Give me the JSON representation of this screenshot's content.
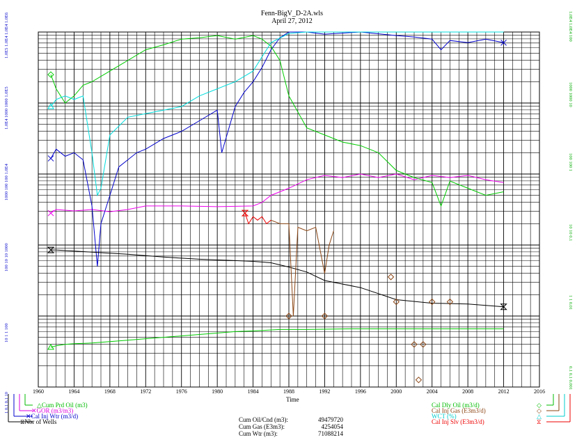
{
  "header": {
    "title": "Fenn-BigV_D-2A.wls",
    "date": "April 27, 2012"
  },
  "chart_data": {
    "type": "line",
    "title": "Fenn-BigV_D-2A.wls",
    "subtitle": "April 27, 2012",
    "xlabel": "Time",
    "x_ticks": [
      1960,
      1964,
      1968,
      1972,
      1976,
      1980,
      1984,
      1988,
      1992,
      1996,
      2000,
      2004,
      2008,
      2012,
      2016
    ],
    "xlim": [
      1960,
      2016
    ],
    "yscale": "log",
    "ylim_decades": 5,
    "grid": true,
    "left_axis_labels": [
      {
        "text": "1.0E5 1.0E4 1.0E4 1.0E6",
        "colors": [
          "#0000cc",
          "#cc00cc",
          "#00aa00",
          "#00cc00"
        ]
      },
      {
        "text": "1.0E4 1000 1000 1.0E5",
        "colors": [
          "#0000cc",
          "#cc00cc",
          "#00aa00",
          "#00cc00"
        ]
      },
      {
        "text": "1000 100 100 1.0E4",
        "colors": [
          "#0000cc",
          "#cc00cc",
          "#00aa00",
          "#00cc00"
        ]
      },
      {
        "text": "100 10 10 1000",
        "colors": [
          "#0000cc",
          "#cc00cc",
          "#00aa00",
          "#00cc00"
        ]
      },
      {
        "text": "10 1 1 100",
        "colors": [
          "#0000cc",
          "#cc00cc",
          "#00aa00",
          "#00cc00"
        ]
      },
      {
        "text": "1 0.1 0.1 10",
        "colors": [
          "#0000cc",
          "#cc00cc",
          "#00aa00",
          "#00cc00"
        ]
      }
    ],
    "right_axis_labels": [
      "1.0E4 1.0E4 100",
      "1000 1000 10",
      "100 100 1",
      "10 10 0.1",
      "1 1 0.01",
      "0.1 0.1 0.001"
    ],
    "series": [
      {
        "name": "Cum Prd Oil (m3)",
        "color": "#00cc00",
        "x": [
          1961.4,
          1962,
          1963,
          1964,
          1966,
          1968,
          1970,
          1972,
          1974,
          1976,
          1978,
          1980,
          1982,
          1984,
          1985.5,
          1987,
          1990,
          1995,
          2000,
          2005,
          2010,
          2012
        ],
        "y": [
          0.56,
          0.58,
          0.6,
          0.61,
          0.62,
          0.64,
          0.66,
          0.68,
          0.7,
          0.72,
          0.74,
          0.76,
          0.78,
          0.79,
          0.8,
          0.81,
          0.81,
          0.82,
          0.82,
          0.82,
          0.82,
          0.82
        ]
      },
      {
        "name": "GOR (m3/m3)",
        "color": "#ee00ee",
        "x": [
          1961.4,
          1962,
          1964,
          1966,
          1968,
          1970,
          1972,
          1976,
          1980,
          1984,
          1985,
          1986,
          1988,
          1990,
          1992,
          1994,
          1996,
          1998,
          2000,
          2002,
          2004,
          2006,
          2008,
          2010,
          2012
        ],
        "y": [
          2.45,
          2.5,
          2.48,
          2.5,
          2.47,
          2.5,
          2.55,
          2.55,
          2.54,
          2.55,
          2.6,
          2.7,
          2.8,
          2.92,
          2.98,
          2.95,
          3.0,
          2.95,
          3.0,
          2.92,
          2.98,
          2.95,
          2.98,
          2.92,
          2.88
        ]
      },
      {
        "name": "Cal Inj Wtr (m3/d)",
        "color": "#0000cc",
        "x": [
          1961.4,
          1962,
          1963,
          1964,
          1965,
          1966,
          1966.6,
          1967,
          1968,
          1969,
          1970,
          1971,
          1972,
          1974,
          1976,
          1978,
          1980,
          1980.5,
          1982,
          1983,
          1984,
          1985,
          1986,
          1987,
          1988,
          1990,
          1992,
          1996,
          2000,
          2002,
          2004,
          2005,
          2006,
          2008,
          2010,
          2012
        ],
        "y": [
          3.22,
          3.35,
          3.25,
          3.3,
          3.2,
          2.55,
          1.7,
          2.3,
          2.7,
          3.1,
          3.2,
          3.3,
          3.35,
          3.5,
          3.6,
          3.75,
          3.9,
          3.3,
          3.95,
          4.15,
          4.3,
          4.5,
          4.75,
          4.92,
          5.0,
          5.0,
          4.97,
          5.0,
          4.95,
          4.93,
          4.9,
          4.75,
          4.88,
          4.85,
          4.9,
          4.85
        ]
      },
      {
        "name": "Nbr of Wells",
        "color": "#000000",
        "x": [
          1961.4,
          1962,
          1966,
          1970,
          1974,
          1978,
          1982,
          1984,
          1986,
          1988,
          1990,
          1992,
          1996,
          2000,
          2004,
          2008,
          2010,
          2012
        ],
        "y": [
          1.93,
          1.93,
          1.9,
          1.87,
          1.83,
          1.8,
          1.78,
          1.77,
          1.75,
          1.69,
          1.62,
          1.5,
          1.4,
          1.23,
          1.18,
          1.17,
          1.15,
          1.13
        ]
      },
      {
        "name": "Cal Dly Oil (m3/d)",
        "color": "#00cc00",
        "x": [
          1961.4,
          1962,
          1963,
          1964,
          1965,
          1966,
          1968,
          1970,
          1972,
          1974,
          1976,
          1978,
          1980,
          1982,
          1984,
          1985,
          1986,
          1987,
          1988,
          1990,
          1992,
          1994,
          1996,
          1998,
          2000,
          2002,
          2004,
          2005,
          2006,
          2008,
          2010,
          2012
        ],
        "y": [
          4.4,
          4.2,
          4.0,
          4.1,
          4.25,
          4.3,
          4.45,
          4.6,
          4.75,
          4.82,
          4.9,
          4.92,
          4.95,
          4.9,
          4.95,
          4.9,
          4.8,
          4.6,
          4.1,
          3.65,
          3.55,
          3.45,
          3.4,
          3.3,
          3.05,
          2.95,
          2.88,
          2.55,
          2.9,
          2.8,
          2.7,
          2.75
        ]
      },
      {
        "name": "WCT (%)",
        "color": "#00dddd",
        "x": [
          1961.4,
          1962,
          1963,
          1964,
          1965,
          1966,
          1966.6,
          1967,
          1968,
          1970,
          1972,
          1974,
          1976,
          1978,
          1980,
          1982,
          1984,
          1985,
          1986,
          1988,
          1990,
          1996,
          2000,
          2004,
          2008,
          2012
        ],
        "y": [
          3.95,
          4.05,
          4.1,
          4.05,
          4.1,
          3.3,
          2.7,
          2.8,
          3.55,
          3.8,
          3.85,
          3.9,
          3.95,
          4.1,
          4.2,
          4.3,
          4.45,
          4.65,
          4.85,
          4.98,
          5.0,
          5.0,
          5.0,
          5.0,
          5.0,
          5.0
        ]
      },
      {
        "name": "Cal Inj Gas (E3m3/d)",
        "color": "#8b4513",
        "x": [
          1986,
          1987,
          1988,
          1988.5,
          1989,
          1990,
          1991,
          1992,
          1992.5,
          1993
        ],
        "y": [
          2.35,
          2.3,
          2.3,
          1.0,
          2.25,
          2.2,
          2.25,
          1.6,
          2.0,
          2.2
        ]
      },
      {
        "name": "Cal Inj Slv (E3m3/d)",
        "color": "#ee0000",
        "x": [
          1983.1,
          1983.5,
          1984,
          1984.5,
          1985,
          1985.5,
          1986
        ],
        "y": [
          2.45,
          2.3,
          2.4,
          2.35,
          2.4,
          2.3,
          2.35
        ]
      }
    ],
    "markers": {
      "cal_inj_gas": [
        {
          "x": 1988.0,
          "y": 1.0
        },
        {
          "x": 1992.0,
          "y": 1.0
        },
        {
          "x": 1999.4,
          "y": 1.55
        },
        {
          "x": 2000.0,
          "y": 1.2
        },
        {
          "x": 2002.0,
          "y": 0.6
        },
        {
          "x": 2003.0,
          "y": 0.6
        },
        {
          "x": 2002.5,
          "y": 0.1
        },
        {
          "x": 2004.0,
          "y": 1.2
        },
        {
          "x": 2006.0,
          "y": 1.2
        }
      ]
    }
  },
  "legend": {
    "left": [
      {
        "symbol": "△",
        "label": "Cum Prd Oil (m3)",
        "color": "#00bb00"
      },
      {
        "symbol": "✕",
        "label": "GOR (m3/m3)",
        "color": "#dd00dd"
      },
      {
        "symbol": "✕",
        "label": "Cal Inj Wtr (m3/d)",
        "color": "#0000cc"
      },
      {
        "symbol": "⧖",
        "label": "Nbr of Wells",
        "color": "#000000"
      }
    ],
    "right": [
      {
        "symbol": "◇",
        "label": "Cal Dly Oil (m3/d)",
        "color": "#00bb00"
      },
      {
        "symbol": "◇",
        "label": "Cal Inj Gas (E3m3/d)",
        "color": "#8b4513"
      },
      {
        "symbol": "△",
        "label": "WCT (%)",
        "color": "#00cccc"
      },
      {
        "symbol": "⧖",
        "label": "Cal Inj Slv (E3m3/d)",
        "color": "#ee0000"
      }
    ]
  },
  "summary": [
    {
      "label": "Cum Oil/Cnd (m3):",
      "value": "49479720"
    },
    {
      "label": "Cum Gas (E3m3):",
      "value": "4254054"
    },
    {
      "label": "Cum Wtr (m3):",
      "value": "71088214"
    }
  ]
}
